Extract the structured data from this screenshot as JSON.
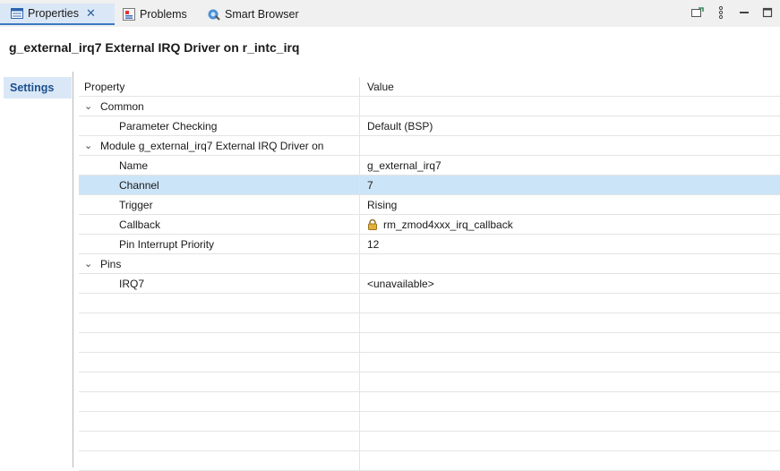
{
  "tabs": [
    {
      "label": "Properties",
      "icon": "properties-icon",
      "active": true
    },
    {
      "label": "Problems",
      "icon": "problems-icon"
    },
    {
      "label": "Smart Browser",
      "icon": "smart-browser-icon"
    }
  ],
  "title": "g_external_irq7 External IRQ Driver on r_intc_irq",
  "side_tab": "Settings",
  "table": {
    "header": {
      "property": "Property",
      "value": "Value"
    },
    "rows": [
      {
        "property": "Common",
        "value": "",
        "group": true
      },
      {
        "property": "Parameter Checking",
        "value": "Default (BSP)"
      },
      {
        "property": "Module g_external_irq7 External IRQ Driver on",
        "value": "",
        "group": true
      },
      {
        "property": "Name",
        "value": "g_external_irq7"
      },
      {
        "property": "Channel",
        "value": "7",
        "selected": true
      },
      {
        "property": "Trigger",
        "value": "Rising"
      },
      {
        "property": "Callback",
        "value": "rm_zmod4xxx_irq_callback",
        "locked": true
      },
      {
        "property": "Pin Interrupt Priority",
        "value": "12"
      },
      {
        "property": "Pins",
        "value": "",
        "group": true
      },
      {
        "property": "IRQ7",
        "value": "<unavailable>"
      }
    ]
  },
  "colors": {
    "selection": "#cce4f7",
    "active_tab": "#dae7f6",
    "accent": "#3b78c2"
  }
}
